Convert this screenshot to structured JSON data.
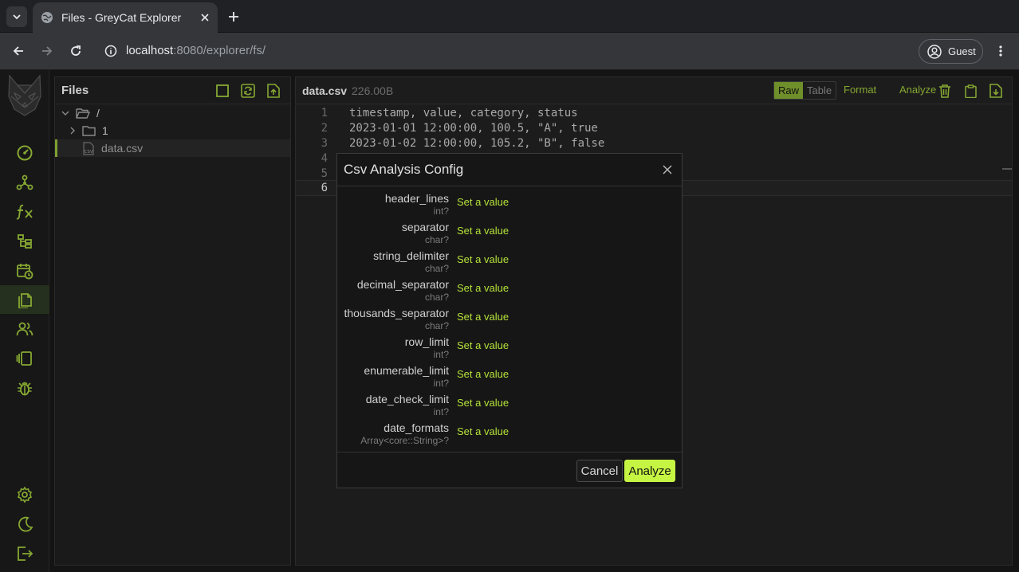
{
  "browser": {
    "tab_title": "Files - GreyCat Explorer",
    "url_host": "localhost",
    "url_path": ":8080/explorer/fs/",
    "profile_label": "Guest"
  },
  "sidebar": {
    "icons": [
      "dashboard-icon",
      "graph-icon",
      "function-icon",
      "hierarchy-icon",
      "calendar-icon",
      "files-icon",
      "users-icon",
      "panels-icon",
      "bug-icon"
    ],
    "bottom_icons": [
      "settings-icon",
      "moon-icon",
      "logout-icon"
    ],
    "active": "files-icon"
  },
  "files_panel": {
    "title": "Files",
    "tree": [
      {
        "label": "/",
        "type": "folder-open"
      },
      {
        "label": "1",
        "type": "folder"
      },
      {
        "label": "data.csv",
        "type": "csv-file"
      }
    ]
  },
  "editor": {
    "file_name": "data.csv",
    "file_size": "226.00B",
    "view_raw": "Raw",
    "view_table": "Table",
    "format_label": "Format",
    "analyze_label": "Analyze",
    "lines": [
      {
        "n": "1",
        "text": "timestamp, value, category, status"
      },
      {
        "n": "2",
        "text": "2023-01-01 12:00:00, 100.5, \"A\", true"
      },
      {
        "n": "3",
        "text": "2023-01-02 12:00:00, 105.2, \"B\", false"
      },
      {
        "n": "4",
        "text": ""
      },
      {
        "n": "5",
        "text": ""
      },
      {
        "n": "6",
        "text": ""
      }
    ]
  },
  "modal": {
    "title": "Csv Analysis Config",
    "set_value_label": "Set a value",
    "fields": [
      {
        "name": "header_lines",
        "type": "int?"
      },
      {
        "name": "separator",
        "type": "char?"
      },
      {
        "name": "string_delimiter",
        "type": "char?"
      },
      {
        "name": "decimal_separator",
        "type": "char?"
      },
      {
        "name": "thousands_separator",
        "type": "char?"
      },
      {
        "name": "row_limit",
        "type": "int?"
      },
      {
        "name": "enumerable_limit",
        "type": "int?"
      },
      {
        "name": "date_check_limit",
        "type": "int?"
      },
      {
        "name": "date_formats",
        "type": "Array<core::String>?"
      }
    ],
    "cancel_label": "Cancel",
    "analyze_label": "Analyze"
  },
  "colors": {
    "accent": "#c5f542",
    "accent_dim": "#7fa12e",
    "icon_green": "#86a832"
  }
}
